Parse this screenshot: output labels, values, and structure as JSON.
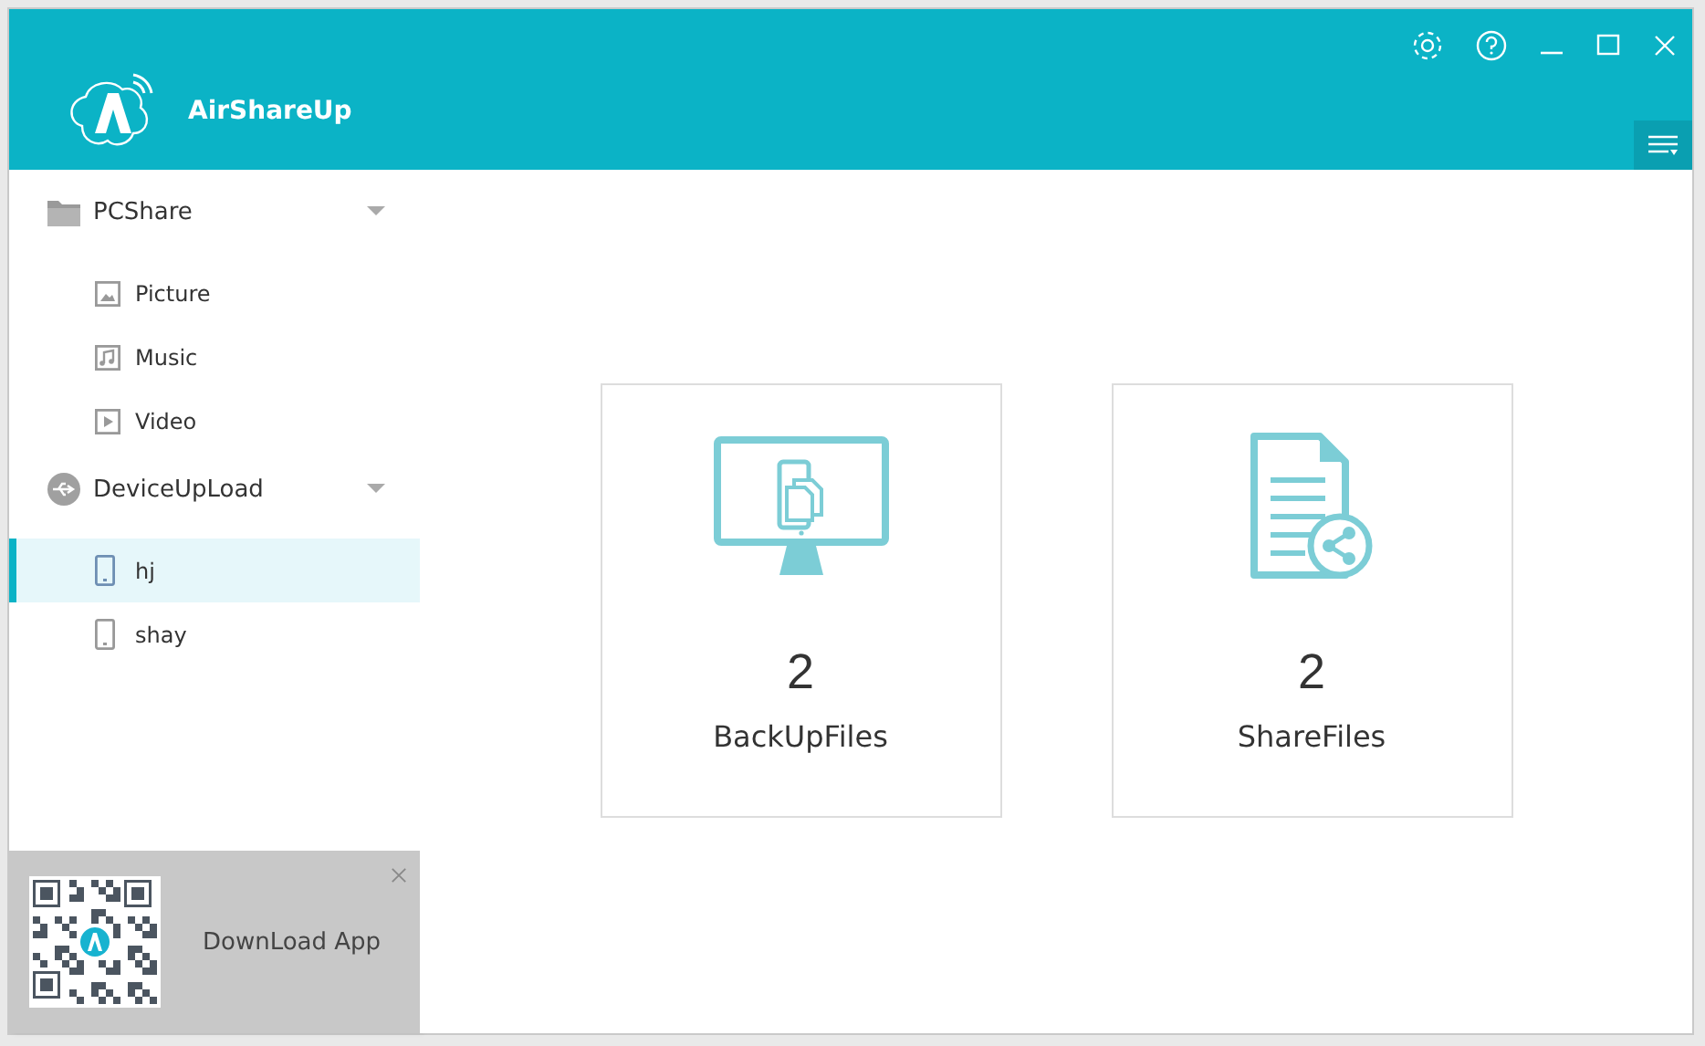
{
  "app": {
    "title": "AirShareUp"
  },
  "sidebar": {
    "groups": [
      {
        "label": "PCShare",
        "kind": "folder",
        "expanded": true,
        "children": [
          {
            "label": "Picture",
            "kind": "picture",
            "selected": false
          },
          {
            "label": "Music",
            "kind": "music",
            "selected": false
          },
          {
            "label": "Video",
            "kind": "video",
            "selected": false
          }
        ]
      },
      {
        "label": "DeviceUpLoad",
        "kind": "usb",
        "expanded": true,
        "children": [
          {
            "label": "hj",
            "kind": "device",
            "selected": true
          },
          {
            "label": "shay",
            "kind": "device",
            "selected": false
          }
        ]
      }
    ]
  },
  "promo": {
    "label": "DownLoad App"
  },
  "cards": [
    {
      "count": "2",
      "label": "BackUpFiles",
      "kind": "backup"
    },
    {
      "count": "2",
      "label": "ShareFiles",
      "kind": "share"
    }
  ]
}
